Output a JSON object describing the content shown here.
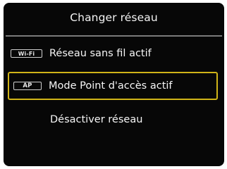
{
  "header": {
    "title": "Changer réseau"
  },
  "menu": {
    "items": [
      {
        "icon_text": "Wi-Fi",
        "icon": "wifi-icon",
        "label": "Réseau sans fil actif",
        "selected": false
      },
      {
        "icon_text": "AP",
        "icon": "access-point-icon",
        "label": "Mode Point d'accès actif",
        "selected": true
      },
      {
        "label": "Désactiver réseau",
        "selected": false
      }
    ]
  },
  "colors": {
    "background": "#070707",
    "text": "#f6f6f6",
    "selection_border": "#d0b418",
    "divider": "#7a7a7a"
  }
}
